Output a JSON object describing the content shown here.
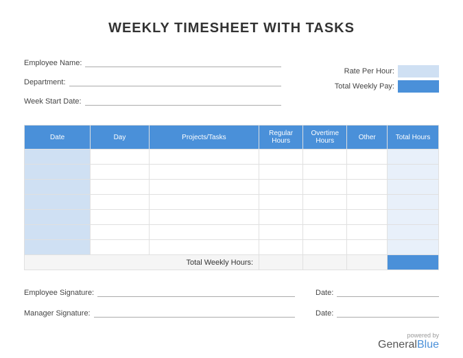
{
  "title": "WEEKLY TIMESHEET WITH TASKS",
  "fields": {
    "emp_name": "Employee Name:",
    "dept": "Department:",
    "week_start": "Week Start Date:",
    "rate": "Rate Per Hour:",
    "total_pay": "Total Weekly Pay:"
  },
  "columns": {
    "date": "Date",
    "day": "Day",
    "tasks": "Projects/Tasks",
    "reg": "Regular Hours",
    "ot": "Overtime Hours",
    "other": "Other",
    "total": "Total Hours"
  },
  "total_row_label": "Total Weekly Hours:",
  "sig": {
    "emp": "Employee Signature:",
    "mgr": "Manager Signature:",
    "date": "Date:"
  },
  "footer": {
    "powered": "powered by",
    "brand1": "General",
    "brand2": "Blue"
  }
}
